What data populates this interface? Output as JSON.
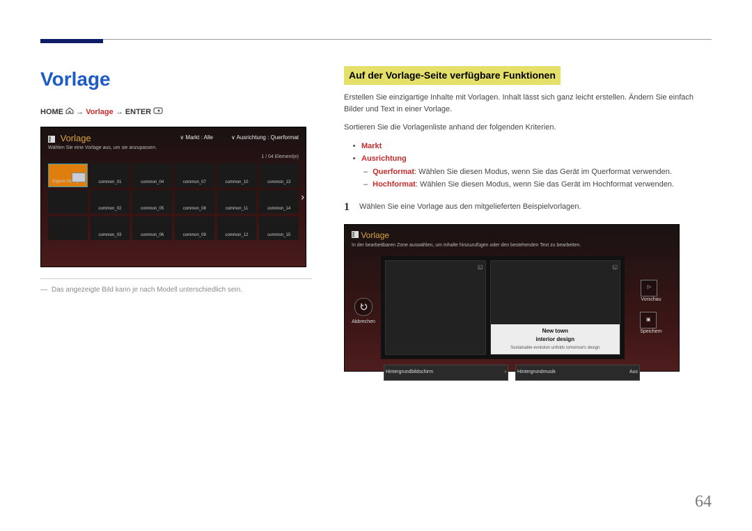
{
  "page_number": "64",
  "left": {
    "title": "Vorlage",
    "breadcrumb": {
      "home": "HOME",
      "mid": "Vorlage",
      "enter": "ENTER",
      "arrow": "→"
    },
    "panel": {
      "title": "Vorlage",
      "subtitle": "Wählen Sie eine Vorlage aus, um sie anzupassen.",
      "filter_market": "Markt : Alle",
      "filter_orient": "Ausrichtung : Querformat",
      "count": "1 / 04 Element(e)",
      "first_cell": "Eigene Vorlagen",
      "cells": [
        "common_01",
        "common_04",
        "common_07",
        "common_10",
        "common_13",
        "common_02",
        "common_05",
        "common_08",
        "common_11",
        "common_14",
        "common_03",
        "common_06",
        "common_09",
        "common_12",
        "common_15"
      ]
    },
    "note": "Das angezeigte Bild kann je nach Modell unterschiedlich sein."
  },
  "right": {
    "heading": "Auf der Vorlage-Seite verfügbare Funktionen",
    "p1": "Erstellen Sie einzigartige Inhalte mit Vorlagen. Inhalt lässt sich ganz leicht erstellen. Ändern Sie einfach Bilder und Text in einer Vorlage.",
    "p2": "Sortieren Sie die Vorlagenliste anhand der folgenden Kriterien.",
    "b1": "Markt",
    "b2": "Ausrichtung",
    "b2a_key": "Querformat",
    "b2a_txt": ": Wählen Sie diesen Modus, wenn Sie das Gerät im Querformat verwenden.",
    "b2b_key": "Hochformat",
    "b2b_txt": ": Wählen Sie diesen Modus, wenn Sie das Gerät im Hochformat verwenden.",
    "step1_num": "1",
    "step1_txt": "Wählen Sie eine Vorlage aus den mitgelieferten Beispielvorlagen.",
    "editor": {
      "title": "Vorlage",
      "subtitle": "In der bearbeitbaren Zone auswählen, um Inhalte hinzuzufügen oder den bestehenden Text zu bearbeiten.",
      "cancel": "Abbrechen",
      "preview": "Vorschau",
      "save": "Speichern",
      "cap1": "New town",
      "cap2": "interior design",
      "cap3": "Sustainable evolution unfolds tomorrow's design",
      "foot1": "Hintergrundbildschirm",
      "foot2": "Hintergrundmusik",
      "foot2_val": "Aus"
    }
  }
}
